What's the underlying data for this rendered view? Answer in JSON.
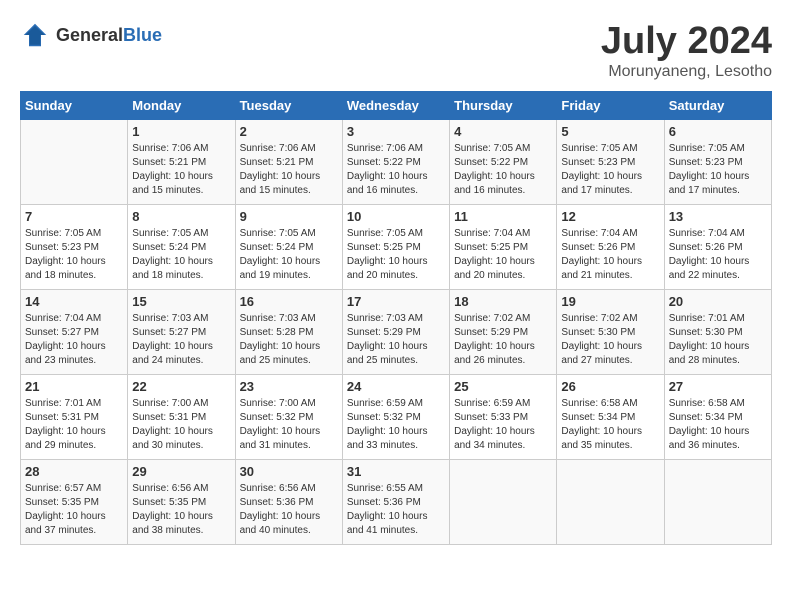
{
  "header": {
    "logo": {
      "general": "General",
      "blue": "Blue"
    },
    "title": "July 2024",
    "location": "Morunyaneng, Lesotho"
  },
  "calendar": {
    "days_of_week": [
      "Sunday",
      "Monday",
      "Tuesday",
      "Wednesday",
      "Thursday",
      "Friday",
      "Saturday"
    ],
    "weeks": [
      [
        {
          "day": "",
          "sunrise": "",
          "sunset": "",
          "daylight": ""
        },
        {
          "day": "1",
          "sunrise": "Sunrise: 7:06 AM",
          "sunset": "Sunset: 5:21 PM",
          "daylight": "Daylight: 10 hours and 15 minutes."
        },
        {
          "day": "2",
          "sunrise": "Sunrise: 7:06 AM",
          "sunset": "Sunset: 5:21 PM",
          "daylight": "Daylight: 10 hours and 15 minutes."
        },
        {
          "day": "3",
          "sunrise": "Sunrise: 7:06 AM",
          "sunset": "Sunset: 5:22 PM",
          "daylight": "Daylight: 10 hours and 16 minutes."
        },
        {
          "day": "4",
          "sunrise": "Sunrise: 7:05 AM",
          "sunset": "Sunset: 5:22 PM",
          "daylight": "Daylight: 10 hours and 16 minutes."
        },
        {
          "day": "5",
          "sunrise": "Sunrise: 7:05 AM",
          "sunset": "Sunset: 5:23 PM",
          "daylight": "Daylight: 10 hours and 17 minutes."
        },
        {
          "day": "6",
          "sunrise": "Sunrise: 7:05 AM",
          "sunset": "Sunset: 5:23 PM",
          "daylight": "Daylight: 10 hours and 17 minutes."
        }
      ],
      [
        {
          "day": "7",
          "sunrise": "Sunrise: 7:05 AM",
          "sunset": "Sunset: 5:23 PM",
          "daylight": "Daylight: 10 hours and 18 minutes."
        },
        {
          "day": "8",
          "sunrise": "Sunrise: 7:05 AM",
          "sunset": "Sunset: 5:24 PM",
          "daylight": "Daylight: 10 hours and 18 minutes."
        },
        {
          "day": "9",
          "sunrise": "Sunrise: 7:05 AM",
          "sunset": "Sunset: 5:24 PM",
          "daylight": "Daylight: 10 hours and 19 minutes."
        },
        {
          "day": "10",
          "sunrise": "Sunrise: 7:05 AM",
          "sunset": "Sunset: 5:25 PM",
          "daylight": "Daylight: 10 hours and 20 minutes."
        },
        {
          "day": "11",
          "sunrise": "Sunrise: 7:04 AM",
          "sunset": "Sunset: 5:25 PM",
          "daylight": "Daylight: 10 hours and 20 minutes."
        },
        {
          "day": "12",
          "sunrise": "Sunrise: 7:04 AM",
          "sunset": "Sunset: 5:26 PM",
          "daylight": "Daylight: 10 hours and 21 minutes."
        },
        {
          "day": "13",
          "sunrise": "Sunrise: 7:04 AM",
          "sunset": "Sunset: 5:26 PM",
          "daylight": "Daylight: 10 hours and 22 minutes."
        }
      ],
      [
        {
          "day": "14",
          "sunrise": "Sunrise: 7:04 AM",
          "sunset": "Sunset: 5:27 PM",
          "daylight": "Daylight: 10 hours and 23 minutes."
        },
        {
          "day": "15",
          "sunrise": "Sunrise: 7:03 AM",
          "sunset": "Sunset: 5:27 PM",
          "daylight": "Daylight: 10 hours and 24 minutes."
        },
        {
          "day": "16",
          "sunrise": "Sunrise: 7:03 AM",
          "sunset": "Sunset: 5:28 PM",
          "daylight": "Daylight: 10 hours and 25 minutes."
        },
        {
          "day": "17",
          "sunrise": "Sunrise: 7:03 AM",
          "sunset": "Sunset: 5:29 PM",
          "daylight": "Daylight: 10 hours and 25 minutes."
        },
        {
          "day": "18",
          "sunrise": "Sunrise: 7:02 AM",
          "sunset": "Sunset: 5:29 PM",
          "daylight": "Daylight: 10 hours and 26 minutes."
        },
        {
          "day": "19",
          "sunrise": "Sunrise: 7:02 AM",
          "sunset": "Sunset: 5:30 PM",
          "daylight": "Daylight: 10 hours and 27 minutes."
        },
        {
          "day": "20",
          "sunrise": "Sunrise: 7:01 AM",
          "sunset": "Sunset: 5:30 PM",
          "daylight": "Daylight: 10 hours and 28 minutes."
        }
      ],
      [
        {
          "day": "21",
          "sunrise": "Sunrise: 7:01 AM",
          "sunset": "Sunset: 5:31 PM",
          "daylight": "Daylight: 10 hours and 29 minutes."
        },
        {
          "day": "22",
          "sunrise": "Sunrise: 7:00 AM",
          "sunset": "Sunset: 5:31 PM",
          "daylight": "Daylight: 10 hours and 30 minutes."
        },
        {
          "day": "23",
          "sunrise": "Sunrise: 7:00 AM",
          "sunset": "Sunset: 5:32 PM",
          "daylight": "Daylight: 10 hours and 31 minutes."
        },
        {
          "day": "24",
          "sunrise": "Sunrise: 6:59 AM",
          "sunset": "Sunset: 5:32 PM",
          "daylight": "Daylight: 10 hours and 33 minutes."
        },
        {
          "day": "25",
          "sunrise": "Sunrise: 6:59 AM",
          "sunset": "Sunset: 5:33 PM",
          "daylight": "Daylight: 10 hours and 34 minutes."
        },
        {
          "day": "26",
          "sunrise": "Sunrise: 6:58 AM",
          "sunset": "Sunset: 5:34 PM",
          "daylight": "Daylight: 10 hours and 35 minutes."
        },
        {
          "day": "27",
          "sunrise": "Sunrise: 6:58 AM",
          "sunset": "Sunset: 5:34 PM",
          "daylight": "Daylight: 10 hours and 36 minutes."
        }
      ],
      [
        {
          "day": "28",
          "sunrise": "Sunrise: 6:57 AM",
          "sunset": "Sunset: 5:35 PM",
          "daylight": "Daylight: 10 hours and 37 minutes."
        },
        {
          "day": "29",
          "sunrise": "Sunrise: 6:56 AM",
          "sunset": "Sunset: 5:35 PM",
          "daylight": "Daylight: 10 hours and 38 minutes."
        },
        {
          "day": "30",
          "sunrise": "Sunrise: 6:56 AM",
          "sunset": "Sunset: 5:36 PM",
          "daylight": "Daylight: 10 hours and 40 minutes."
        },
        {
          "day": "31",
          "sunrise": "Sunrise: 6:55 AM",
          "sunset": "Sunset: 5:36 PM",
          "daylight": "Daylight: 10 hours and 41 minutes."
        },
        {
          "day": "",
          "sunrise": "",
          "sunset": "",
          "daylight": ""
        },
        {
          "day": "",
          "sunrise": "",
          "sunset": "",
          "daylight": ""
        },
        {
          "day": "",
          "sunrise": "",
          "sunset": "",
          "daylight": ""
        }
      ]
    ]
  }
}
